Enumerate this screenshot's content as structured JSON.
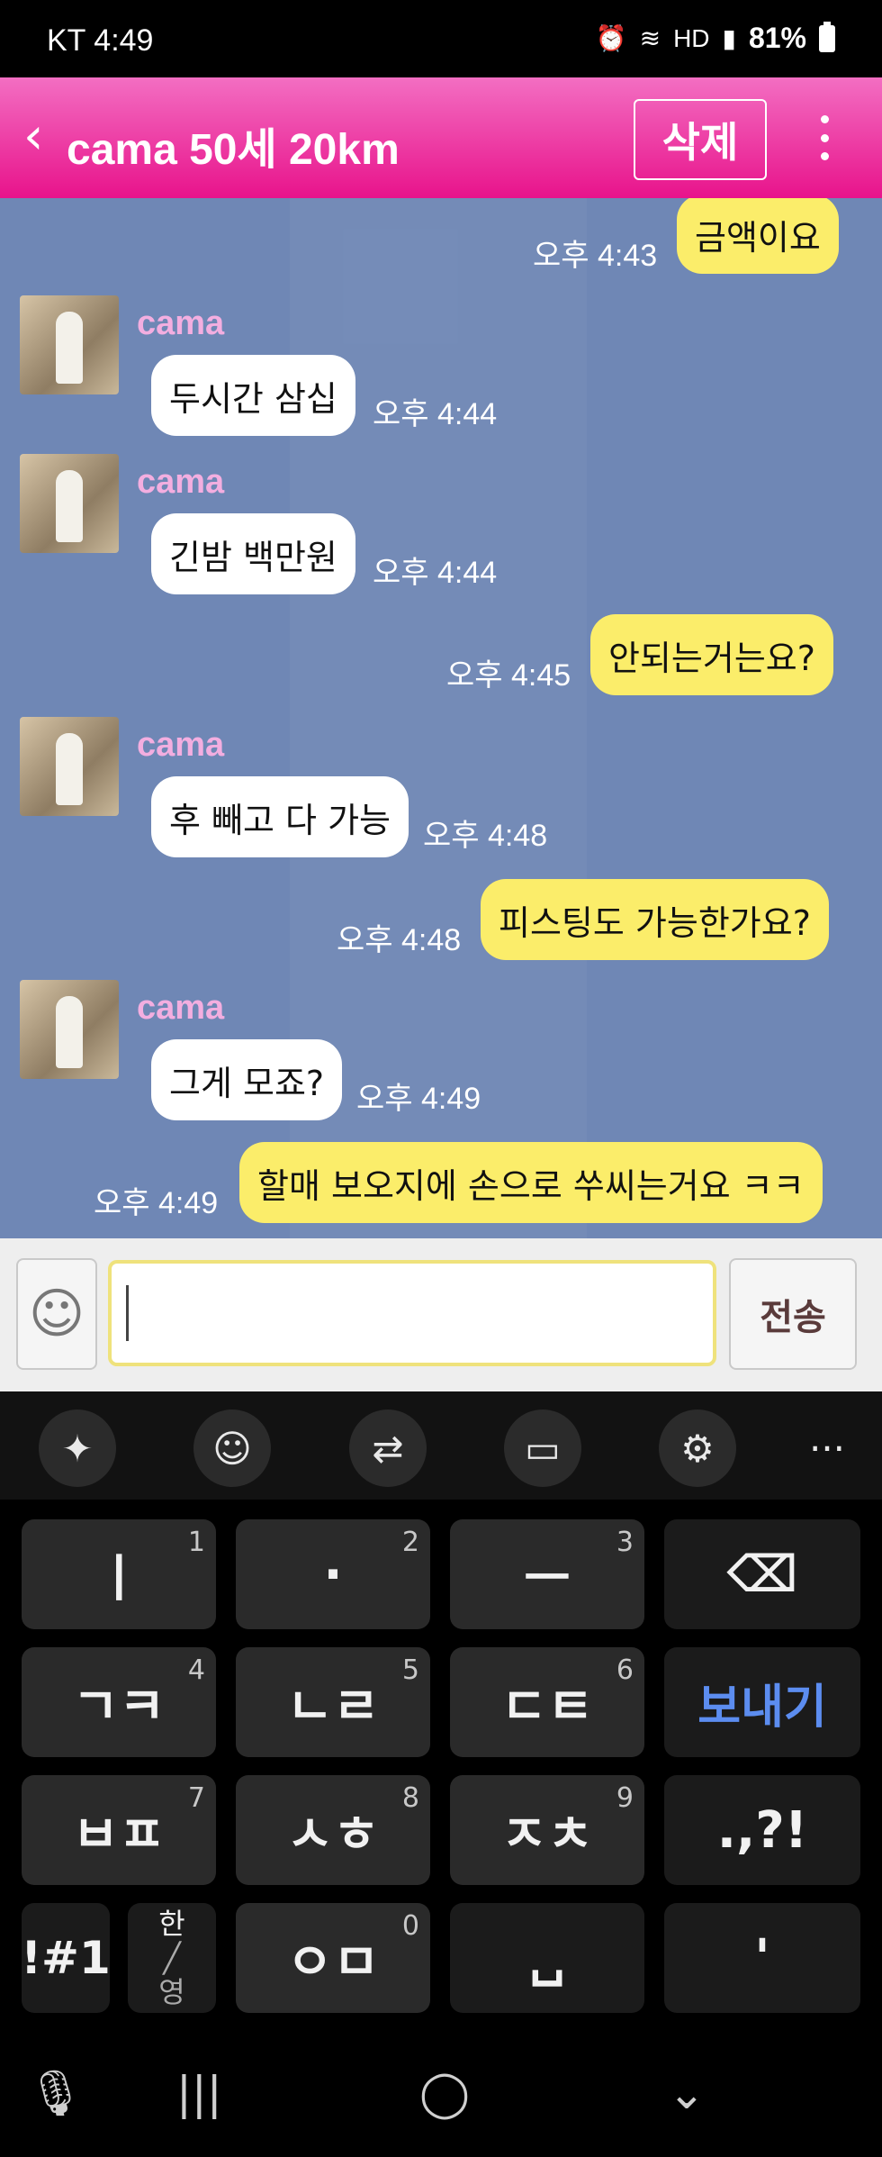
{
  "status_bar": {
    "carrier_time": "KT 4:49",
    "battery": "81%",
    "icons": [
      "alarm-icon",
      "wifi-icon",
      "hd-icon",
      "signal-icon",
      "battery-icon"
    ]
  },
  "header": {
    "title": "cama 50세 20km",
    "delete_label": "삭제",
    "back_icon": "chevron-left-icon",
    "menu_icon": "kebab-menu-icon",
    "bg_colors": [
      "#f36ec2",
      "#e8138b"
    ]
  },
  "chat": {
    "bg_color": "#6f87b5",
    "messages": [
      {
        "direction": "out",
        "text": "금액이요",
        "time": "오후 4:43"
      },
      {
        "direction": "in",
        "sender": "cama",
        "text": "두시간 삼십",
        "time": "오후 4:44"
      },
      {
        "direction": "in",
        "sender": "cama",
        "text": "긴밤 백만원",
        "time": "오후 4:44"
      },
      {
        "direction": "out",
        "text": "안되는거는요?",
        "time": "오후 4:45"
      },
      {
        "direction": "in",
        "sender": "cama",
        "text": "후 빼고 다 가능",
        "time": "오후 4:48"
      },
      {
        "direction": "out",
        "text": "피스팅도 가능한가요?",
        "time": "오후 4:48"
      },
      {
        "direction": "in",
        "sender": "cama",
        "text": "그게 모죠?",
        "time": "오후 4:49"
      },
      {
        "direction": "out",
        "text": "할매 보오지에 손으로 쑤씨는거요 ㅋㅋ",
        "time": "오후 4:49"
      }
    ]
  },
  "input_bar": {
    "value": "",
    "send_label": "전송",
    "emoji_icon": "smiley-icon"
  },
  "keyboard": {
    "toolbar_icons": [
      "sparkle-icon",
      "emoji-icon",
      "translate-icon",
      "clipboard-icon",
      "settings-icon",
      "more-icon"
    ],
    "more_label": "···",
    "rows": [
      [
        {
          "label": "ㅣ",
          "hint": "1"
        },
        {
          "label": "·",
          "hint": "2"
        },
        {
          "label": "ㅡ",
          "hint": "3"
        },
        {
          "label": "⌫",
          "hint": ""
        }
      ],
      [
        {
          "label": "ㄱㅋ",
          "hint": "4"
        },
        {
          "label": "ㄴㄹ",
          "hint": "5"
        },
        {
          "label": "ㄷㅌ",
          "hint": "6"
        },
        {
          "label": "보내기",
          "hint": ""
        }
      ],
      [
        {
          "label": "ㅂㅍ",
          "hint": "7"
        },
        {
          "label": "ㅅㅎ",
          "hint": "8"
        },
        {
          "label": "ㅈㅊ",
          "hint": "9"
        },
        {
          "label": ".,?!",
          "hint": ""
        }
      ],
      [
        {
          "label": "!#1",
          "hint": ""
        },
        {
          "label": "한/영",
          "hint": ""
        },
        {
          "label": "ㅇㅁ",
          "hint": "0"
        },
        {
          "label": "␣",
          "hint": ""
        },
        {
          "label": "'",
          "hint": ""
        }
      ]
    ],
    "lang_top": "한",
    "lang_bottom": "영"
  },
  "nav_bar": {
    "items": [
      "mic-icon",
      "recents-icon",
      "home-icon",
      "hide-keyboard-icon"
    ],
    "glyphs": [
      "🎙",
      "|||",
      "◯",
      "⌄"
    ]
  }
}
